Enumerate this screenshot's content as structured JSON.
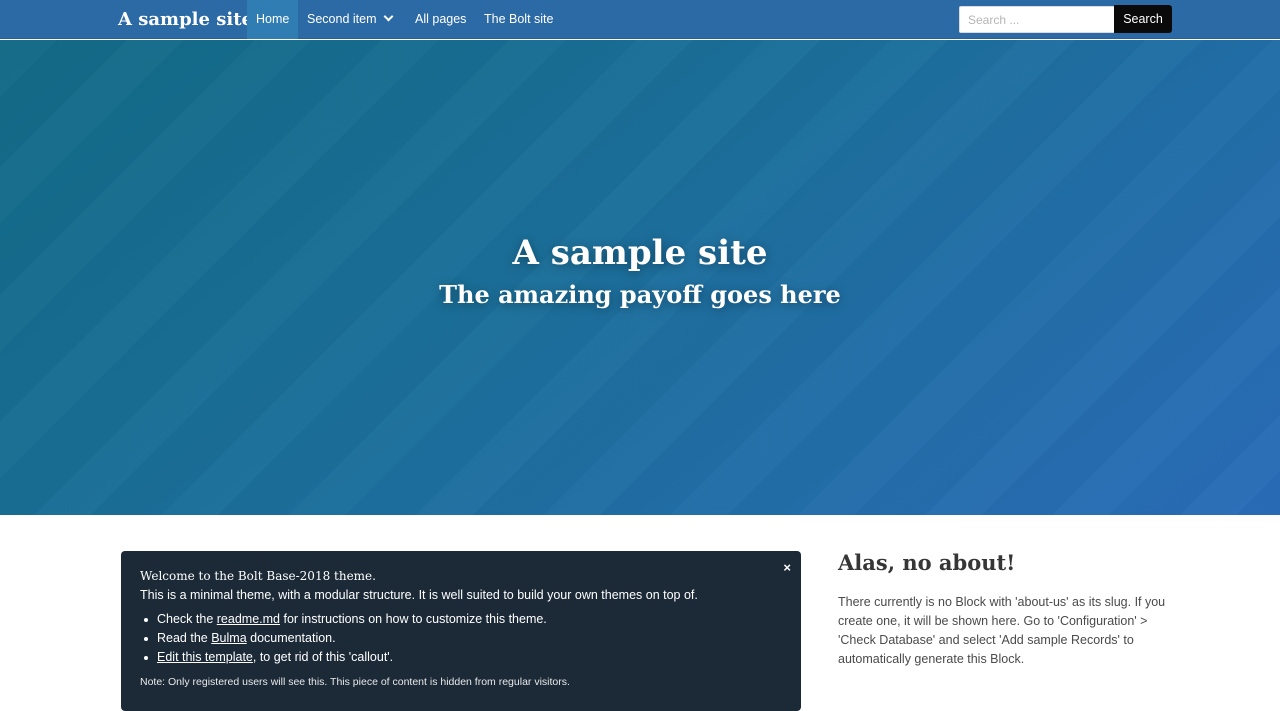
{
  "navbar": {
    "brand": "A sample site",
    "items": [
      {
        "label": "Home",
        "active": true
      },
      {
        "label": "Second item",
        "has_dropdown": true
      },
      {
        "label": "All pages"
      },
      {
        "label": "The Bolt site"
      }
    ],
    "search_placeholder": "Search ...",
    "search_button": "Search"
  },
  "hero": {
    "title": "A sample site",
    "subtitle": "The amazing payoff goes here"
  },
  "callout": {
    "close": "×",
    "heading": "Welcome to the Bolt Base-2018 theme.",
    "text": "This is a minimal theme, with a modular structure. It is well suited to build your own themes on top of.",
    "items": [
      {
        "before": "Check the ",
        "link": "readme.md",
        "after": " for instructions on how to customize this theme."
      },
      {
        "before": "Read the ",
        "link": "Bulma",
        "after": " documentation."
      },
      {
        "before": "",
        "link": "Edit this template",
        "after": ", to get rid of this 'callout'."
      }
    ],
    "note": "Note: Only registered users will see this. This piece of content is hidden from regular visitors."
  },
  "sidebar": {
    "title": "Alas, no about!",
    "text": "There currently is no Block with 'about-us' as its slug. If you create one, it will be shown here. Go to 'Configuration' > 'Check Database' and select 'Add sample Records' to automatically generate this Block."
  },
  "colors": {
    "navbar": "#2c6aa6",
    "callout_bg": "#1c2a38",
    "search_button": "#0a0a0a"
  }
}
